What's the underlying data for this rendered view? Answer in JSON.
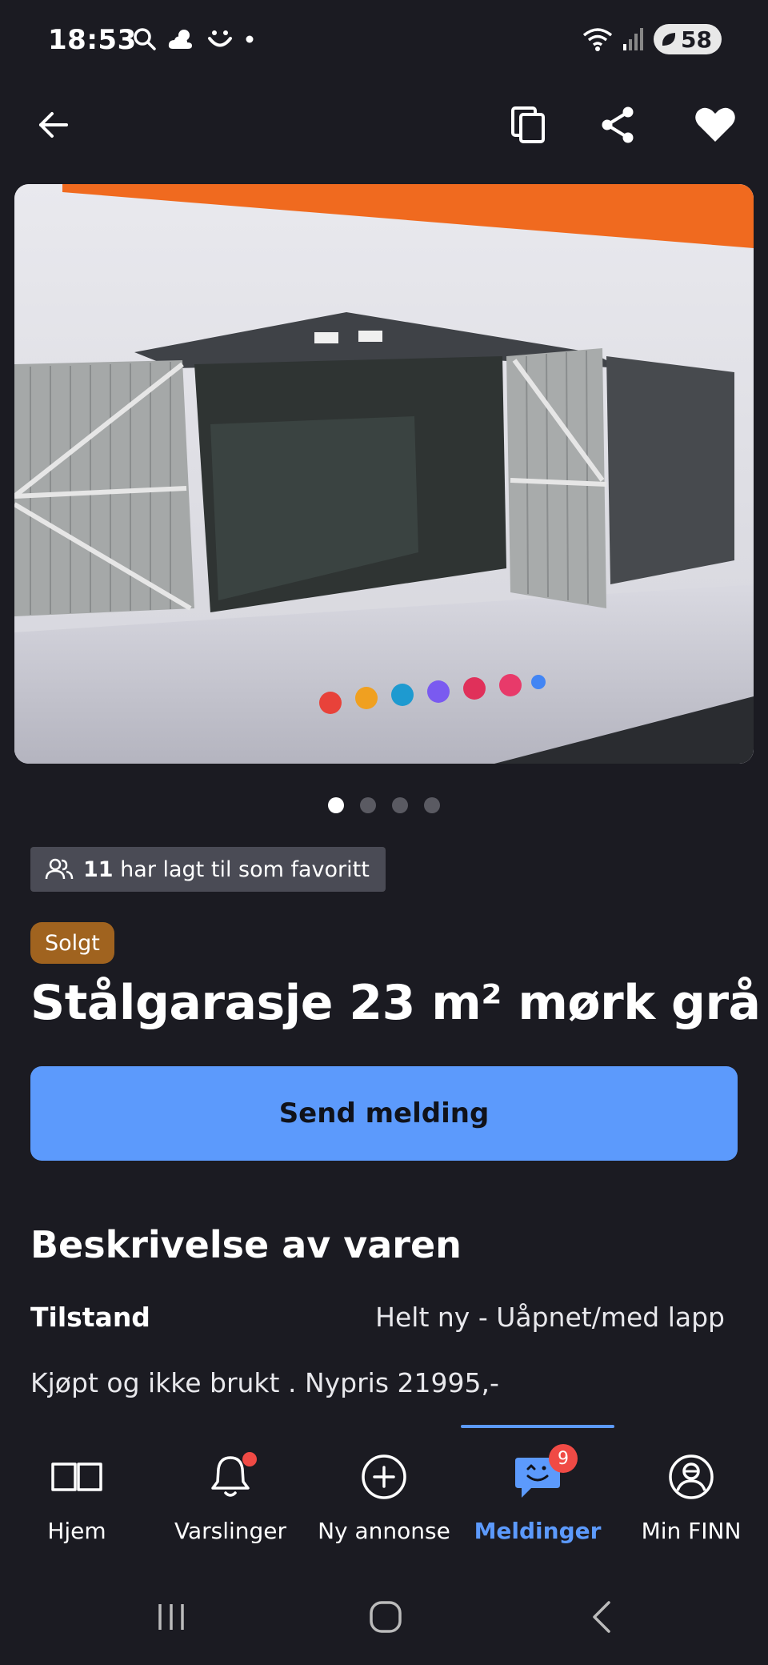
{
  "status_bar": {
    "time": "18:53",
    "battery": "58"
  },
  "listing": {
    "photo_count": 4,
    "active_photo": 1,
    "favorites_count": "11",
    "favorites_text": " har lagt til som favoritt",
    "status_badge": "Solgt",
    "title": "Stålgarasje 23 m² mørk grå",
    "send_button_label": "Send melding",
    "description_heading": "Beskrivelse av varen",
    "condition_label": "Tilstand",
    "condition_value": "Helt ny - Uåpnet/med lapp",
    "description_text": "Kjøpt og ikke brukt . Nypris 21995,-"
  },
  "tabs": [
    {
      "label": "Hjem",
      "icon": "book-icon"
    },
    {
      "label": "Varslinger",
      "icon": "bell-icon"
    },
    {
      "label": "Ny annonse",
      "icon": "plus-circle-icon"
    },
    {
      "label": "Meldinger",
      "icon": "chat-icon",
      "badge": "9",
      "active": true
    },
    {
      "label": "Min FINN",
      "icon": "profile-icon"
    }
  ],
  "colors": {
    "background": "#1b1b22",
    "accent": "#5c9afc",
    "sold_badge": "#a0631f",
    "notification": "#f04a45"
  }
}
